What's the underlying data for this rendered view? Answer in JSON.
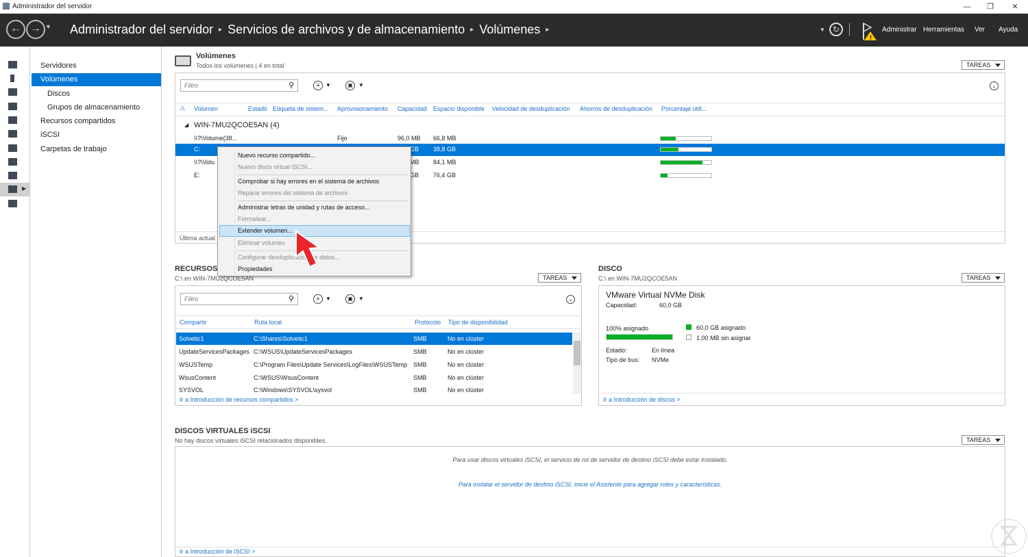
{
  "window": {
    "title": "Administrador del servidor",
    "min": "—",
    "restore": "❐",
    "close": "✕"
  },
  "header": {
    "back": "←",
    "forward": "→",
    "breadcrumb": [
      "Administrador del servidor",
      "Servicios de archivos y de almacenamiento",
      "Volúmenes"
    ],
    "sep": "▸",
    "menu": [
      "Administrar",
      "Herramientas",
      "Ver",
      "Ayuda"
    ],
    "notify_icon": "warning-flag-icon",
    "refresh_icon": "refresh-icon"
  },
  "nav": {
    "items": [
      {
        "label": "Servidores",
        "sub": false,
        "selected": false
      },
      {
        "label": "Volúmenes",
        "sub": false,
        "selected": true
      },
      {
        "label": "Discos",
        "sub": true,
        "selected": false
      },
      {
        "label": "Grupos de almacenamiento",
        "sub": true,
        "selected": false
      },
      {
        "label": "Recursos compartidos",
        "sub": false,
        "selected": false
      },
      {
        "label": "iSCSI",
        "sub": false,
        "selected": false
      },
      {
        "label": "Carpetas de trabajo",
        "sub": false,
        "selected": false
      }
    ]
  },
  "volumes": {
    "title": "Volúmenes",
    "subtitle": "Todos los volúmenes | 4 en total",
    "tasks": "TAREAS",
    "filter_placeholder": "Filtro",
    "columns": [
      "Volumen",
      "Estado",
      "Etiqueta de sistem...",
      "Aprovisionamiento",
      "Capacidad",
      "Espacio disponible",
      "Velocidad de desduplicación",
      "Ahorros de desduplicación",
      "Porcentaje utili..."
    ],
    "group": "WIN-7MU2QCOE5AN (4)",
    "rows": [
      {
        "volume": "\\\\?\\Volume{38...",
        "prov": "Fijo",
        "cap": "96,0 MB",
        "free": "66,8 MB",
        "pct": 0.3
      },
      {
        "volume": "C:",
        "prov": "",
        "cap": "GB",
        "free": "38,8 GB",
        "pct": 0.35
      },
      {
        "volume": "\\\\?\\Volu",
        "prov": "",
        "cap": "MB",
        "free": "84,1 MB",
        "pct": 0.82
      },
      {
        "volume": "E:",
        "prov": "",
        "cap": "GB",
        "free": "76,4 GB",
        "pct": 0.14
      }
    ],
    "footer": "Última actual"
  },
  "context_menu": {
    "items": [
      {
        "label": "Nuevo recurso compartido...",
        "disabled": false
      },
      {
        "label": "Nuevo disco virtual iSCSI...",
        "disabled": true
      },
      {
        "label": "Comprobar si hay errores en el sistema de archivos",
        "disabled": false
      },
      {
        "label": "Reparar errores del sistema de archivos",
        "disabled": true
      },
      {
        "label": "Administrar letras de unidad y rutas de acceso...",
        "disabled": false
      },
      {
        "label": "Formatear...",
        "disabled": true
      },
      {
        "label": "Extender volumen...",
        "disabled": false,
        "highlighted": true
      },
      {
        "label": "Eliminar volumen",
        "disabled": true
      },
      {
        "label": "Configurar desduplicación de datos...",
        "disabled": true
      },
      {
        "label": "Propiedades",
        "disabled": false
      }
    ]
  },
  "shares": {
    "title": "RECURSOS C",
    "subtitle": "C:\\ en WIN-7MU2QCOE5AN",
    "tasks": "TAREAS",
    "filter_placeholder": "Filtro",
    "columns": [
      "Compartir",
      "Ruta local",
      "Protocolo",
      "Tipo de disponibilidad"
    ],
    "rows": [
      {
        "name": "Solvetic1",
        "path": "C:\\Shares\\Solvetic1",
        "proto": "SMB",
        "avail": "No en clúster"
      },
      {
        "name": "UpdateServicesPackages",
        "path": "C:\\WSUS\\UpdateServicesPackages",
        "proto": "SMB",
        "avail": "No en clúster"
      },
      {
        "name": "WSUSTemp",
        "path": "C:\\Program Files\\Update Services\\LogFiles\\WSUSTemp",
        "proto": "SMB",
        "avail": "No en clúster"
      },
      {
        "name": "WsusContent",
        "path": "C:\\WSUS\\WsusContent",
        "proto": "SMB",
        "avail": "No en clúster"
      },
      {
        "name": "SYSVOL",
        "path": "C:\\Windows\\SYSVOL\\sysvol",
        "proto": "SMB",
        "avail": "No en clúster"
      }
    ],
    "link": "Ir a Introducción de recursos compartidos >"
  },
  "disk": {
    "title": "DISCO",
    "subtitle": "C:\\ en WIN-7MU2QCOE5AN",
    "tasks": "TAREAS",
    "name": "VMware Virtual NVMe Disk",
    "capacity_label": "Capacidad:",
    "capacity_value": "60,0 GB",
    "allocated_label": "100% asignado",
    "allocated_fraction": 1.0,
    "legend_allocated": "60,0 GB asignado",
    "legend_unallocated": "1,00 MB sin asignar",
    "status_label": "Estado:",
    "status_value": "En línea",
    "bus_label": "Tipo de bus:",
    "bus_value": "NVMe",
    "link": "Ir a Introducción de discos >"
  },
  "iscsi": {
    "title": "DISCOS VIRTUALES iSCSI",
    "subtitle": "No hay discos virtuales iSCSI relacionados disponibles.",
    "tasks": "TAREAS",
    "msg1": "Para usar discos virtuales iSCSI, el servicio de rol de servidor de destino iSCSI debe estar instalado.",
    "msg2": "Para instalar el servidor de destino iSCSI, inicie el Asistente para agregar roles y características.",
    "link": "Ir a Introducción de iSCSI >"
  },
  "colors": {
    "accent": "#0078d7",
    "header_bg": "#2b2b2b",
    "bar_fill": "#06b025",
    "link": "#1a6fc7"
  }
}
